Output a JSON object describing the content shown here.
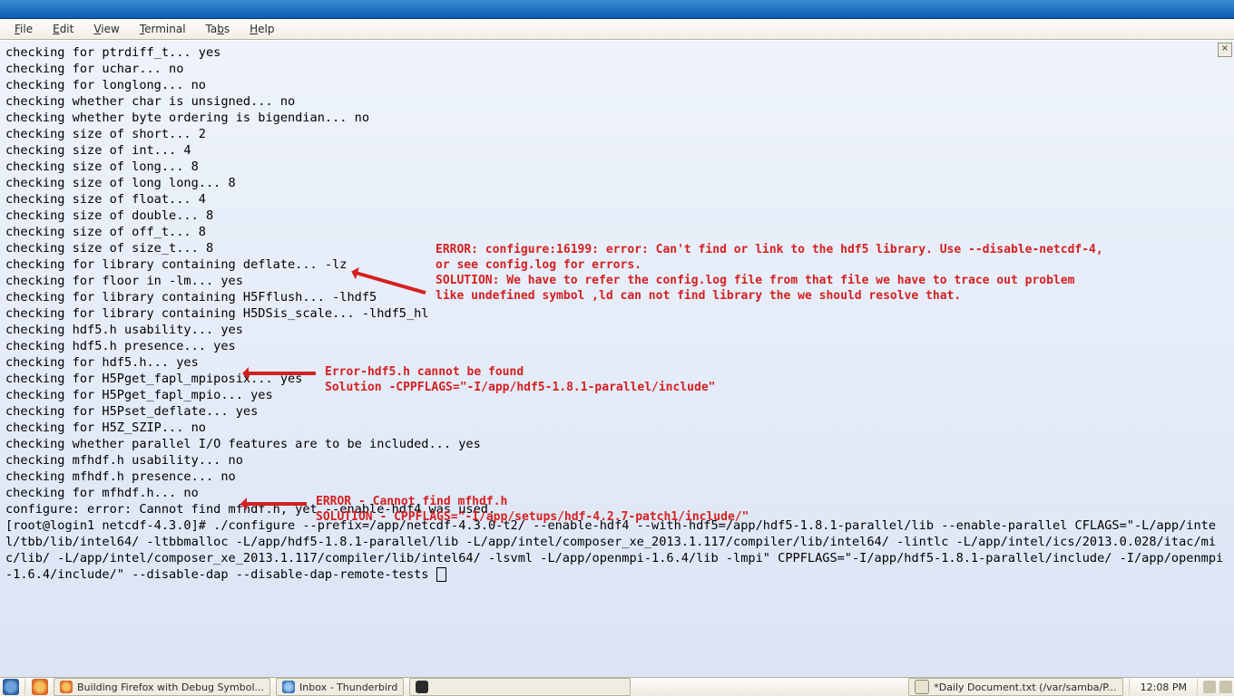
{
  "menubar": {
    "file": "File",
    "edit": "Edit",
    "view": "View",
    "terminal": "Terminal",
    "tabs": "Tabs",
    "help": "Help"
  },
  "close_button": "×",
  "terminal_output": "checking for ptrdiff_t... yes\nchecking for uchar... no\nchecking for longlong... no\nchecking whether char is unsigned... no\nchecking whether byte ordering is bigendian... no\nchecking size of short... 2\nchecking size of int... 4\nchecking size of long... 8\nchecking size of long long... 8\nchecking size of float... 4\nchecking size of double... 8\nchecking size of off_t... 8\nchecking size of size_t... 8\nchecking for library containing deflate... -lz\nchecking for floor in -lm... yes\nchecking for library containing H5Fflush... -lhdf5\nchecking for library containing H5DSis_scale... -lhdf5_hl\nchecking hdf5.h usability... yes\nchecking hdf5.h presence... yes\nchecking for hdf5.h... yes\nchecking for H5Pget_fapl_mpiposix... yes\nchecking for H5Pget_fapl_mpio... yes\nchecking for H5Pset_deflate... yes\nchecking for H5Z_SZIP... no\nchecking whether parallel I/O features are to be included... yes\nchecking mfhdf.h usability... no\nchecking mfhdf.h presence... no\nchecking for mfhdf.h... no\nconfigure: error: Cannot find mfhdf.h, yet --enable-hdf4 was used.\n[root@login1 netcdf-4.3.0]# ./configure --prefix=/app/netcdf-4.3.0-t2/ --enable-hdf4 --with-hdf5=/app/hdf5-1.8.1-parallel/lib --enable-parallel CFLAGS=\"-L/app/intel/tbb/lib/intel64/ -ltbbmalloc -L/app/hdf5-1.8.1-parallel/lib -L/app/intel/composer_xe_2013.1.117/compiler/lib/intel64/ -lintlc -L/app/intel/ics/2013.0.028/itac/mic/lib/ -L/app/intel/composer_xe_2013.1.117/compiler/lib/intel64/ -lsvml -L/app/openmpi-1.6.4/lib -lmpi\" CPPFLAGS=\"-I/app/hdf5-1.8.1-parallel/include/ -I/app/openmpi-1.6.4/include/\" --disable-dap --disable-dap-remote-tests ",
  "annot1": "ERROR: configure:16199: error: Can't find or link to the hdf5 library. Use --disable-netcdf-4,\nor see config.log for errors.\nSOLUTION: We have to refer the config.log file from that file we have to trace out problem\nlike undefined symbol ,ld can not find library the we should resolve that.",
  "annot2": "Error-hdf5.h cannot be found\nSolution -CPPFLAGS=\"-I/app/hdf5-1.8.1-parallel/include\"",
  "annot3": "ERROR - Cannot find mfhdf.h\nSOLUTION - CPPFLAGS=\"-I/app/setups/hdf-4.2.7-patch1/include/\"",
  "taskbar": {
    "btn1": "Building Firefox with Debug Symbol...",
    "btn2": "Inbox - Thunderbird",
    "btn3": "",
    "btn4": "*Daily Document.txt  (/var/samba/P...",
    "clock": "12:08 PM"
  }
}
